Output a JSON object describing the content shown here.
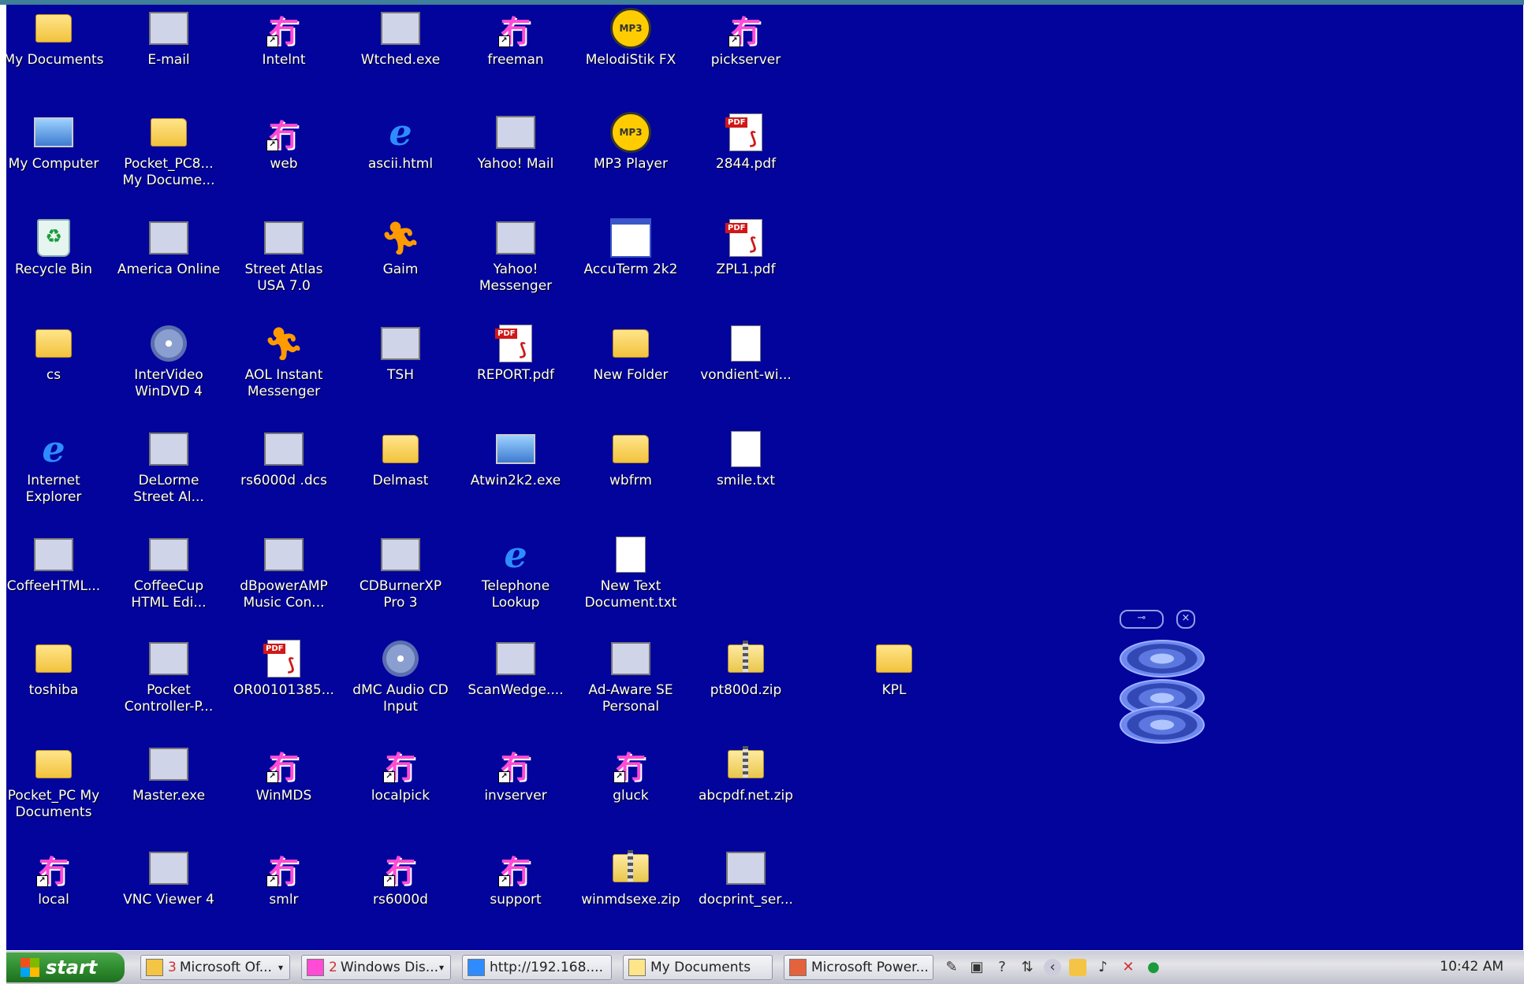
{
  "desktop": {
    "background_color": "#02049c",
    "icons": [
      {
        "label": "My Documents",
        "icon": "my-documents-folder-icon"
      },
      {
        "label": "E-mail",
        "icon": "email-icon"
      },
      {
        "label": "Intelnt",
        "icon": "hh-shortcut-icon"
      },
      {
        "label": "Wtched.exe",
        "icon": "pentagram-icon"
      },
      {
        "label": "freeman",
        "icon": "hh-shortcut-icon"
      },
      {
        "label": "MelodiStik FX",
        "icon": "mp3-icon"
      },
      {
        "label": "pickserver",
        "icon": "hh-shortcut-icon"
      },
      {
        "label": "My Computer",
        "icon": "my-computer-icon"
      },
      {
        "label": "Pocket_PC8...\nMy Docume...",
        "icon": "sync-folder-icon"
      },
      {
        "label": "web",
        "icon": "hh-shortcut-icon"
      },
      {
        "label": "ascii.html",
        "icon": "html-file-icon"
      },
      {
        "label": "Yahoo! Mail",
        "icon": "yahoo-mail-icon"
      },
      {
        "label": "MP3 Player",
        "icon": "mp3-icon"
      },
      {
        "label": "2844.pdf",
        "icon": "pdf-icon"
      },
      {
        "label": "Recycle Bin",
        "icon": "recycle-bin-icon"
      },
      {
        "label": "America Online",
        "icon": "aol-icon"
      },
      {
        "label": "Street Atlas\nUSA 7.0",
        "icon": "street-atlas-icon"
      },
      {
        "label": "Gaim",
        "icon": "gaim-icon"
      },
      {
        "label": "Yahoo!\nMessenger",
        "icon": "yahoo-messenger-icon"
      },
      {
        "label": "AccuTerm 2k2",
        "icon": "terminal-window-icon"
      },
      {
        "label": "ZPL1.pdf",
        "icon": "pdf-icon"
      },
      {
        "label": "cs",
        "icon": "folder-icon"
      },
      {
        "label": "InterVideo\nWinDVD 4",
        "icon": "dvd-icon"
      },
      {
        "label": "AOL Instant\nMessenger",
        "icon": "aim-icon"
      },
      {
        "label": "TSH",
        "icon": "network-icon"
      },
      {
        "label": "REPORT.pdf",
        "icon": "pdf-icon"
      },
      {
        "label": "New Folder",
        "icon": "folder-icon"
      },
      {
        "label": "vondient-wi...",
        "icon": "document-icon"
      },
      {
        "label": "Internet\nExplorer",
        "icon": "internet-explorer-icon"
      },
      {
        "label": "DeLorme\nStreet Al...",
        "icon": "delorme-icon"
      },
      {
        "label": "rs6000d .dcs",
        "icon": "terminal-icon"
      },
      {
        "label": "Delmast",
        "icon": "folder-icon"
      },
      {
        "label": "Atwin2k2.exe",
        "icon": "computer-screen-icon"
      },
      {
        "label": "wbfrm",
        "icon": "folder-icon"
      },
      {
        "label": "smile.txt",
        "icon": "text-file-icon"
      },
      {
        "label": "CoffeeHTML...",
        "icon": "coffee-html-icon"
      },
      {
        "label": "CoffeeCup\nHTML Edi...",
        "icon": "coffeecup-icon"
      },
      {
        "label": "dBpowerAMP\nMusic Con...",
        "icon": "speaker-icon"
      },
      {
        "label": "CDBurnerXP\nPro 3",
        "icon": "cd-burner-icon"
      },
      {
        "label": "Telephone\nLookup",
        "icon": "internet-explorer-icon"
      },
      {
        "label": "New Text\nDocument.txt",
        "icon": "text-file-icon"
      },
      {
        "label": "",
        "icon": "empty"
      },
      {
        "label": "toshiba",
        "icon": "folder-icon"
      },
      {
        "label": "Pocket\nController-P...",
        "icon": "pocket-controller-icon"
      },
      {
        "label": "OR00101385...",
        "icon": "pdf-icon"
      },
      {
        "label": "dMC Audio CD\nInput",
        "icon": "audio-cd-icon"
      },
      {
        "label": "ScanWedge....",
        "icon": "scanwedge-icon"
      },
      {
        "label": "Ad-Aware SE\nPersonal",
        "icon": "ad-aware-icon"
      },
      {
        "label": "pt800d.zip",
        "icon": "zip-icon"
      },
      {
        "label": "Pocket_PC My\nDocuments",
        "icon": "sync-folder-icon"
      },
      {
        "label": "Master.exe",
        "icon": "master-exe-icon"
      },
      {
        "label": "WinMDS",
        "icon": "hh-shortcut-icon"
      },
      {
        "label": "localpick",
        "icon": "hh-shortcut-icon"
      },
      {
        "label": "invserver",
        "icon": "hh-shortcut-icon"
      },
      {
        "label": "gluck",
        "icon": "hh-shortcut-icon"
      },
      {
        "label": "abcpdf.net.zip",
        "icon": "zip-icon"
      },
      {
        "label": "local",
        "icon": "hh-shortcut-icon"
      },
      {
        "label": "VNC Viewer 4",
        "icon": "vnc-icon"
      },
      {
        "label": "smlr",
        "icon": "hh-shortcut-icon"
      },
      {
        "label": "rs6000d",
        "icon": "hh-shortcut-icon"
      },
      {
        "label": "support",
        "icon": "hh-shortcut-icon"
      },
      {
        "label": "winmdsexe.zip",
        "icon": "zip-icon"
      },
      {
        "label": "docprint_ser...",
        "icon": "printer-icon"
      }
    ],
    "extra_icon": {
      "label": "KPL",
      "icon": "folder-icon"
    }
  },
  "taskbar": {
    "start_label": "start",
    "tasks": [
      {
        "count": "3",
        "label": "Microsoft Of...",
        "grouped": true
      },
      {
        "count": "2",
        "label": "Windows Dis...",
        "grouped": true
      },
      {
        "count": "",
        "label": "http://192.168....",
        "grouped": false
      },
      {
        "count": "",
        "label": "My Documents",
        "grouped": false
      },
      {
        "count": "",
        "label": "Microsoft Power...",
        "grouped": false
      }
    ],
    "clock": "10:42 AM"
  }
}
